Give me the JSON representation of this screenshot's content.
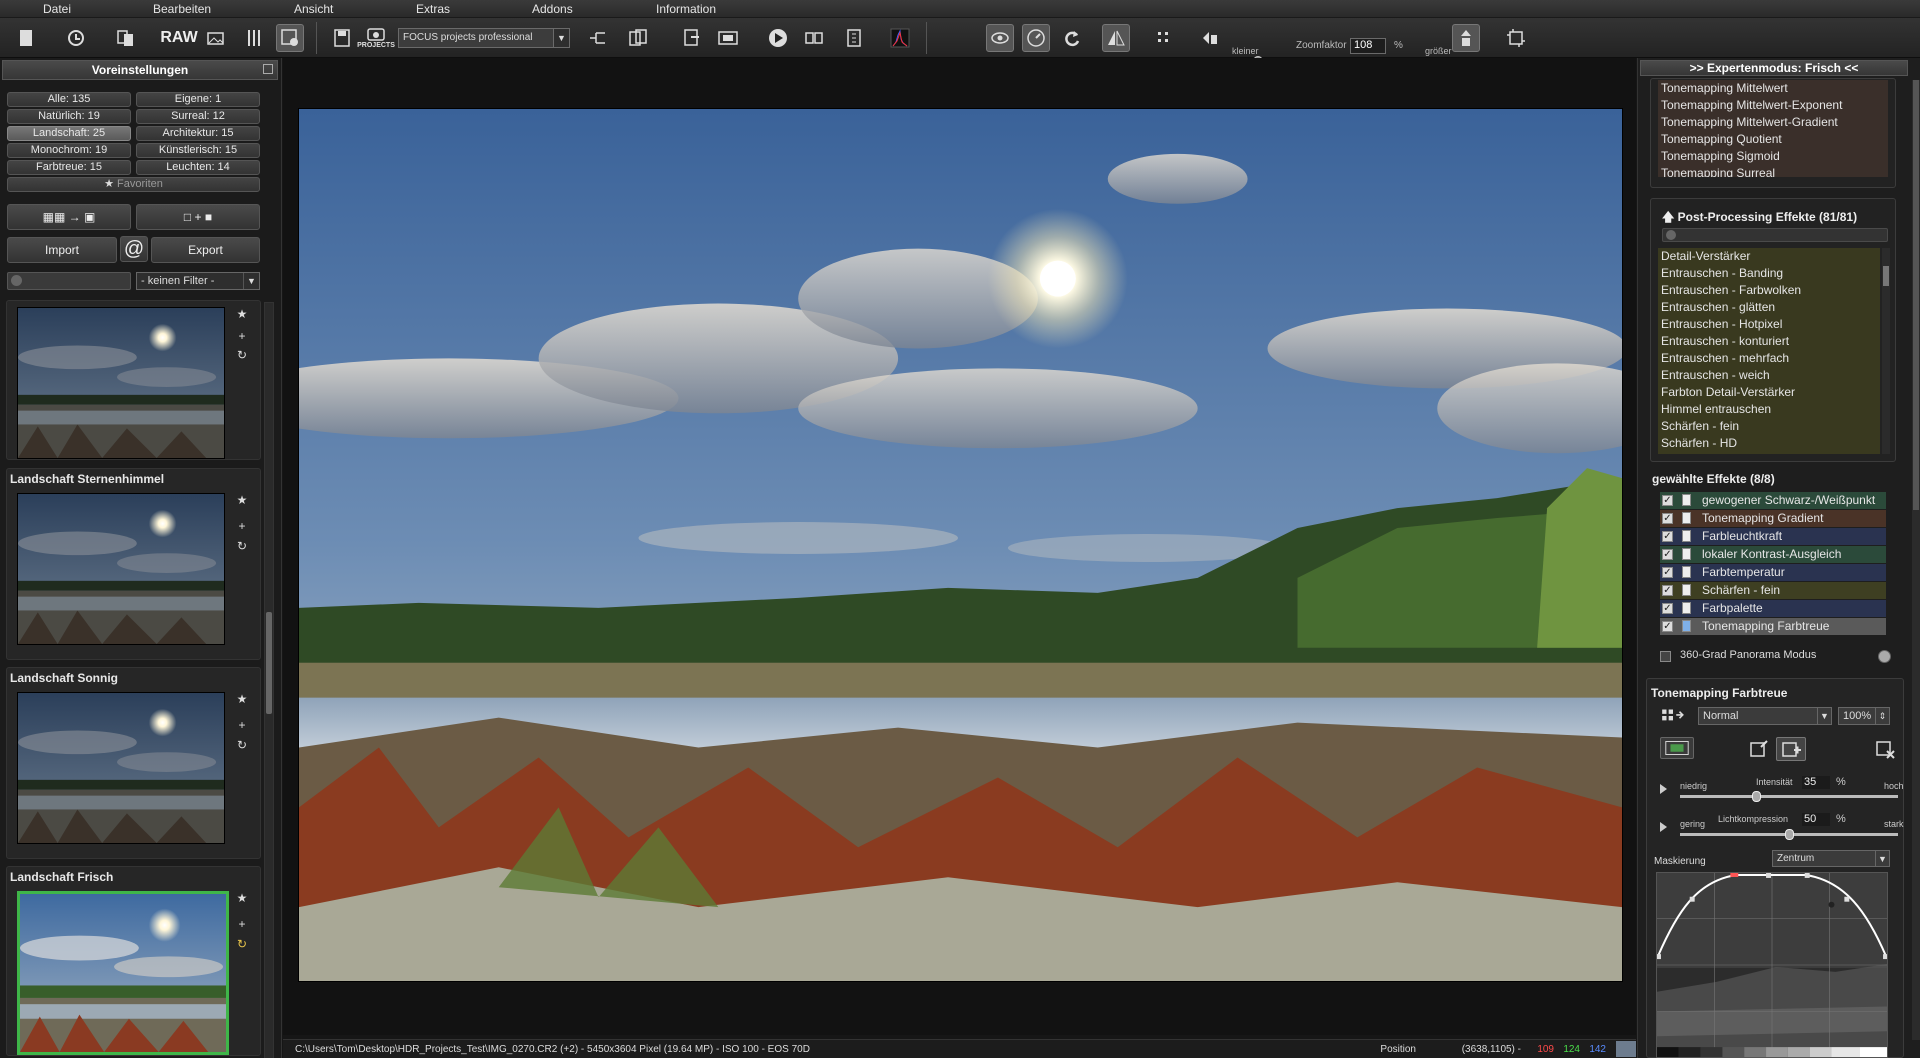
{
  "menu": [
    "Datei",
    "Bearbeiten",
    "Ansicht",
    "Extras",
    "Addons",
    "Information"
  ],
  "toolbar": {
    "raw_label": "RAW",
    "projects_label": "PROJECTS",
    "project_mode": "FOCUS projects professional",
    "zoom_small": "kleiner",
    "zoom_large": "größer",
    "zoom_label": "Zoomfaktor",
    "zoom_value": "108",
    "zoom_unit": "%",
    "icons": [
      "new-file-icon",
      "history-icon",
      "copy-icon",
      "raw-icon",
      "image-import-icon",
      "tools-icon",
      "settings-icon",
      "save-icon",
      "projects-icon",
      "batch-icon",
      "export-icon",
      "compare-icon",
      "play-icon",
      "slideshow-icon",
      "info-icon",
      "histogram-icon",
      "eye-icon",
      "dial-icon",
      "redo-icon",
      "mirror-icon",
      "grid-icon",
      "split-view-icon",
      "crop-icon"
    ]
  },
  "left_panel": {
    "header": "Voreinstellungen",
    "categories": [
      {
        "label": "Alle: 135",
        "selected": false
      },
      {
        "label": "Eigene: 1",
        "selected": false
      },
      {
        "label": "Natürlich: 19",
        "selected": false
      },
      {
        "label": "Surreal: 12",
        "selected": false
      },
      {
        "label": "Landschaft: 25",
        "selected": true
      },
      {
        "label": "Architektur: 15",
        "selected": false
      },
      {
        "label": "Monochrom: 19",
        "selected": false
      },
      {
        "label": "Künstlerisch: 15",
        "selected": false
      },
      {
        "label": "Farbtreue: 15",
        "selected": false
      },
      {
        "label": "Leuchten: 14",
        "selected": false
      }
    ],
    "favorites": "Favoriten",
    "import": "Import",
    "at": "@",
    "export": "Export",
    "filter": "- keinen Filter -",
    "presets": [
      {
        "title": ""
      },
      {
        "title": "Landschaft Sternenhimmel"
      },
      {
        "title": "Landschaft Sonnig"
      },
      {
        "title": "Landschaft Frisch"
      }
    ]
  },
  "status": {
    "path": "C:\\Users\\Tom\\Desktop\\HDR_Projects_Test\\IMG_0270.CR2 (+2) - 5450x3604 Pixel (19.64 MP)   - ISO 100 - EOS 70D",
    "position_label": "Position",
    "coords": "(3638,1105) -",
    "r": "109",
    "g": "124",
    "b": "142"
  },
  "right_panel": {
    "header": ">> Expertenmodus: Frisch <<",
    "tonemapping": [
      "Tonemapping Mittelwert",
      "Tonemapping Mittelwert-Exponent",
      "Tonemapping Mittelwert-Gradient",
      "Tonemapping Quotient",
      "Tonemapping Sigmoid",
      "Tonemapping Surreal"
    ],
    "post_title": "Post-Processing Effekte (81/81)",
    "post_effects": [
      "Detail-Verstärker",
      "Entrauschen - Banding",
      "Entrauschen - Farbwolken",
      "Entrauschen - glätten",
      "Entrauschen - Hotpixel",
      "Entrauschen - konturiert",
      "Entrauschen - mehrfach",
      "Entrauschen - weich",
      "Farbton Detail-Verstärker",
      "Himmel entrauschen",
      "Schärfen - fein",
      "Schärfen - HD"
    ],
    "selected_title": "gewählte Effekte (8/8)",
    "selected": [
      {
        "label": "gewogener Schwarz-/Weißpunkt",
        "color": "#2b4a3a"
      },
      {
        "label": "Tonemapping Gradient",
        "color": "#4a3327"
      },
      {
        "label": "Farbleuchtkraft",
        "color": "#2a3350"
      },
      {
        "label": "lokaler Kontrast-Ausgleich",
        "color": "#2b4a3a"
      },
      {
        "label": "Farbtemperatur",
        "color": "#2a3350"
      },
      {
        "label": "Schärfen - fein",
        "color": "#3e3f22"
      },
      {
        "label": "Farbpalette",
        "color": "#2a3350"
      },
      {
        "label": "Tonemapping Farbtreue",
        "color": "#5a5a5a"
      }
    ],
    "panorama": "360-Grad Panorama Modus",
    "effect_title": "Tonemapping Farbtreue",
    "blend": "Normal",
    "opacity": "100%",
    "sliders": [
      {
        "low": "niedrig",
        "label": "Intensität",
        "value": "35",
        "unit": "%",
        "high": "hoch",
        "level": 0.35
      },
      {
        "low": "gering",
        "label": "Lichtkompression",
        "value": "50",
        "unit": "%",
        "high": "stark",
        "level": 0.5
      }
    ],
    "mask_label": "Maskierung",
    "mask_mode": "Zentrum"
  }
}
